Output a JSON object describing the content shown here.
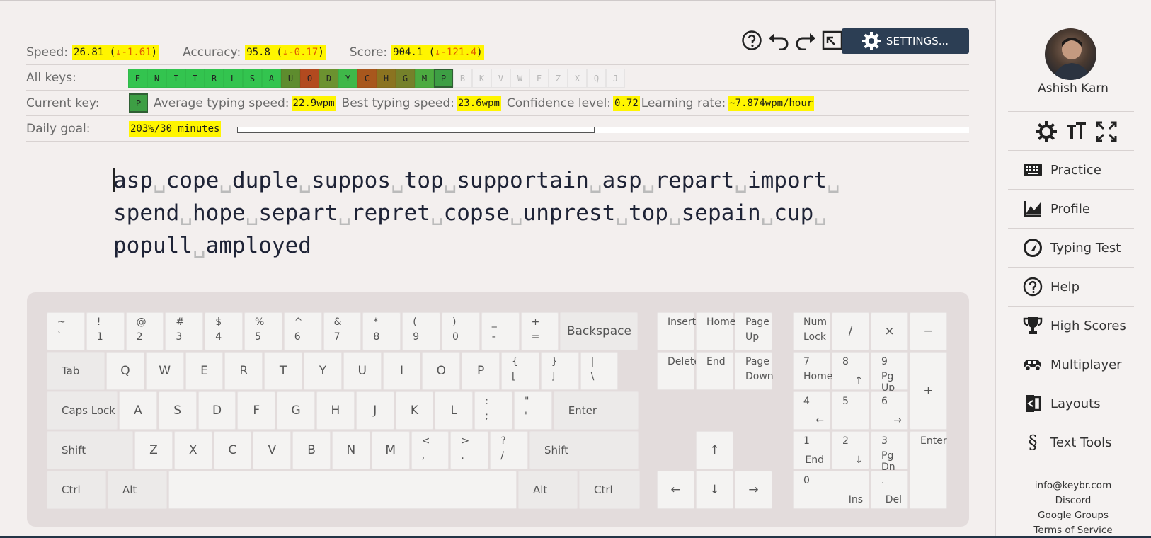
{
  "stats": {
    "speed_label": "Speed:",
    "speed_value": "26.81",
    "speed_delta": "-1.61",
    "accuracy_label": "Accuracy:",
    "accuracy_value": "95.8",
    "accuracy_delta": "-0.17",
    "score_label": "Score:",
    "score_value": "904.1",
    "score_delta": "-121.4",
    "delta_arrow": "↓"
  },
  "all_keys": {
    "label": "All keys:",
    "keys": [
      {
        "k": "E",
        "color": "#33c44f"
      },
      {
        "k": "N",
        "color": "#33c44f"
      },
      {
        "k": "I",
        "color": "#33c44f"
      },
      {
        "k": "T",
        "color": "#33c44f"
      },
      {
        "k": "R",
        "color": "#33c44f"
      },
      {
        "k": "L",
        "color": "#33c44f"
      },
      {
        "k": "S",
        "color": "#33c44f"
      },
      {
        "k": "A",
        "color": "#33c44f"
      },
      {
        "k": "U",
        "color": "#5e8c2e"
      },
      {
        "k": "O",
        "color": "#b24a1f"
      },
      {
        "k": "D",
        "color": "#6c9230"
      },
      {
        "k": "Y",
        "color": "#3fb849"
      },
      {
        "k": "C",
        "color": "#a8571d"
      },
      {
        "k": "H",
        "color": "#8b7320"
      },
      {
        "k": "G",
        "color": "#75812a"
      },
      {
        "k": "M",
        "color": "#4cab40"
      },
      {
        "k": "P",
        "color": "#3d9e44",
        "current": true
      },
      {
        "k": "B"
      },
      {
        "k": "K"
      },
      {
        "k": "V"
      },
      {
        "k": "W"
      },
      {
        "k": "F"
      },
      {
        "k": "Z"
      },
      {
        "k": "X"
      },
      {
        "k": "Q"
      },
      {
        "k": "J"
      }
    ]
  },
  "current_key": {
    "label": "Current key:",
    "key": "P",
    "key_color": "#3d9e44",
    "avg_label": "Average typing speed:",
    "avg_value": "22.9wpm",
    "best_label": "Best typing speed:",
    "best_value": "23.6wpm",
    "conf_label": "Confidence level:",
    "conf_value": "0.72",
    "rate_label": "Learning rate:",
    "rate_value": "~7.874wpm/hour"
  },
  "daily_goal": {
    "label": "Daily goal:",
    "value": "203%/30 minutes",
    "progress": 1.0
  },
  "lesson_lines": [
    [
      "asp",
      "cope",
      "duple",
      "suppos",
      "top",
      "supportain",
      "asp",
      "repart",
      "import"
    ],
    [
      "spend",
      "hope",
      "separt",
      "repret",
      "copse",
      "unprest",
      "top",
      "sepain",
      "cup"
    ],
    [
      "popull",
      "amployed"
    ]
  ],
  "toolbar": {
    "settings_label": "SETTINGS..."
  },
  "keyboard": {
    "row1": [
      [
        "~",
        "`"
      ],
      [
        "!",
        "1"
      ],
      [
        "@",
        "2"
      ],
      [
        "#",
        "3"
      ],
      [
        "$",
        "4"
      ],
      [
        "%",
        "5"
      ],
      [
        "^",
        "6"
      ],
      [
        "&",
        "7"
      ],
      [
        "*",
        "8"
      ],
      [
        "(",
        "9"
      ],
      [
        ")",
        "0"
      ],
      [
        "_",
        "-"
      ],
      [
        "+",
        "="
      ]
    ],
    "backspace": "Backspace",
    "tab": "Tab",
    "row2": [
      "Q",
      "W",
      "E",
      "R",
      "T",
      "Y",
      "U",
      "I",
      "O",
      "P"
    ],
    "row2_sym": [
      [
        "{",
        "["
      ],
      [
        "}",
        "]"
      ],
      [
        "|",
        "\\"
      ]
    ],
    "capslock": "Caps Lock",
    "row3": [
      "A",
      "S",
      "D",
      "F",
      "G",
      "H",
      "J",
      "K",
      "L"
    ],
    "row3_sym": [
      [
        ":",
        ";"
      ],
      [
        "\"",
        "'"
      ]
    ],
    "enter": "Enter",
    "shift": "Shift",
    "row4": [
      "Z",
      "X",
      "C",
      "V",
      "B",
      "N",
      "M"
    ],
    "row4_sym": [
      [
        "<",
        ","
      ],
      [
        ">",
        "."
      ],
      [
        "?",
        "/"
      ]
    ],
    "ctrl": "Ctrl",
    "alt": "Alt",
    "nav": {
      "insert": "Insert",
      "home": "Home",
      "pageup": [
        "Page",
        "Up"
      ],
      "delete": "Delete",
      "end": "End",
      "pagedown": [
        "Page",
        "Down"
      ]
    },
    "arrows": {
      "up": "↑",
      "left": "←",
      "down": "↓",
      "right": "→"
    },
    "numpad": {
      "numlock": [
        "Num",
        "Lock"
      ],
      "div": "/",
      "mul": "×",
      "minus": "−",
      "plus": "+",
      "enter": "Enter",
      "n7": [
        "7",
        "Home"
      ],
      "n8": [
        "8",
        "↑"
      ],
      "n9": [
        "9",
        "Pg Up"
      ],
      "n4": [
        "4",
        "←"
      ],
      "n5": [
        "5",
        ""
      ],
      "n6": [
        "6",
        "→"
      ],
      "n1": [
        "1",
        "End"
      ],
      "n2": [
        "2",
        "↓"
      ],
      "n3": [
        "3",
        "Pg Dn"
      ],
      "n0": [
        "0",
        "Ins"
      ],
      "ndot": [
        ".",
        "Del"
      ]
    }
  },
  "sidebar": {
    "user_name": "Ashish Karn",
    "nav": [
      "Practice",
      "Profile",
      "Typing Test",
      "Help",
      "High Scores",
      "Multiplayer",
      "Layouts",
      "Text Tools"
    ],
    "footer": [
      "info@keybr.com",
      "Discord",
      "Google Groups",
      "Terms of Service"
    ]
  }
}
